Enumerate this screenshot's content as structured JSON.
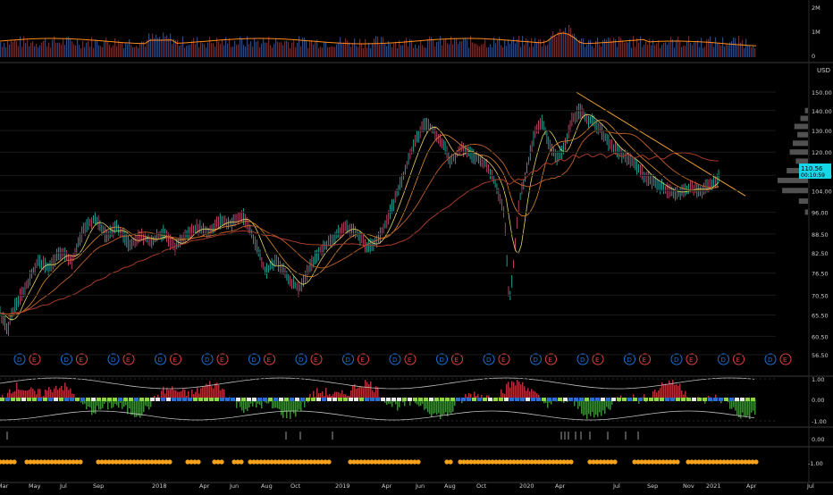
{
  "chart_data": {
    "type": "line",
    "currency_label": "USD",
    "price_tag": "110.56",
    "price_tag_sub": "00:10:59",
    "price_ticks": [
      "150.00",
      "140.00",
      "130.00",
      "120.00",
      "110.00",
      "104.00",
      "96.00",
      "88.50",
      "82.50",
      "76.50",
      "70.50",
      "65.50",
      "60.50",
      "56.50"
    ],
    "price_tick_values": [
      150,
      140,
      130,
      120,
      110,
      104,
      96,
      88.5,
      82.5,
      76.5,
      70.5,
      65.5,
      60.5,
      56.5
    ],
    "volume_ticks": [
      "2M",
      "1M",
      "0"
    ],
    "osc_ticks": [
      "1.00",
      "0.00",
      "-1.00"
    ],
    "small_ticks": [
      "0.00"
    ],
    "dot_ticks": [
      "-1.00"
    ],
    "time_labels": [
      "Mar",
      "May",
      "Jul",
      "Sep",
      "2018",
      "Apr",
      "Jun",
      "Aug",
      "Oct",
      "2019",
      "Apr",
      "Jun",
      "Aug",
      "Oct",
      "2020",
      "Apr",
      "Jul",
      "Sep",
      "Nov",
      "2021",
      "Apr",
      "Jul"
    ],
    "events": [
      "D",
      "E",
      "D",
      "E",
      "D",
      "E",
      "D",
      "E",
      "D",
      "E",
      "D",
      "E",
      "D",
      "E",
      "D",
      "E",
      "D",
      "E",
      "D",
      "E",
      "D",
      "E",
      "D",
      "E",
      "D",
      "E",
      "D",
      "E",
      "D",
      "E",
      "D",
      "E",
      "D",
      "E"
    ],
    "event_colors": {
      "D": "#1e6fd9",
      "E": "#e04040"
    },
    "price_series": [
      {
        "t": 0.0,
        "v": 66
      },
      {
        "t": 0.01,
        "v": 62
      },
      {
        "t": 0.02,
        "v": 68
      },
      {
        "t": 0.035,
        "v": 73
      },
      {
        "t": 0.05,
        "v": 80
      },
      {
        "t": 0.065,
        "v": 78
      },
      {
        "t": 0.08,
        "v": 83
      },
      {
        "t": 0.095,
        "v": 80
      },
      {
        "t": 0.11,
        "v": 90
      },
      {
        "t": 0.125,
        "v": 94
      },
      {
        "t": 0.14,
        "v": 88
      },
      {
        "t": 0.155,
        "v": 91
      },
      {
        "t": 0.17,
        "v": 85
      },
      {
        "t": 0.185,
        "v": 88
      },
      {
        "t": 0.2,
        "v": 86
      },
      {
        "t": 0.215,
        "v": 89
      },
      {
        "t": 0.23,
        "v": 84
      },
      {
        "t": 0.245,
        "v": 88
      },
      {
        "t": 0.26,
        "v": 91
      },
      {
        "t": 0.275,
        "v": 89
      },
      {
        "t": 0.29,
        "v": 93
      },
      {
        "t": 0.305,
        "v": 92
      },
      {
        "t": 0.32,
        "v": 95
      },
      {
        "t": 0.335,
        "v": 87
      },
      {
        "t": 0.35,
        "v": 77
      },
      {
        "t": 0.365,
        "v": 80
      },
      {
        "t": 0.38,
        "v": 75
      },
      {
        "t": 0.395,
        "v": 72
      },
      {
        "t": 0.41,
        "v": 79
      },
      {
        "t": 0.425,
        "v": 84
      },
      {
        "t": 0.44,
        "v": 87
      },
      {
        "t": 0.455,
        "v": 91
      },
      {
        "t": 0.47,
        "v": 89
      },
      {
        "t": 0.485,
        "v": 84
      },
      {
        "t": 0.5,
        "v": 87
      },
      {
        "t": 0.515,
        "v": 96
      },
      {
        "t": 0.53,
        "v": 108
      },
      {
        "t": 0.545,
        "v": 122
      },
      {
        "t": 0.56,
        "v": 134
      },
      {
        "t": 0.57,
        "v": 131
      },
      {
        "t": 0.58,
        "v": 126
      },
      {
        "t": 0.595,
        "v": 116
      },
      {
        "t": 0.61,
        "v": 122
      },
      {
        "t": 0.625,
        "v": 118
      },
      {
        "t": 0.64,
        "v": 115
      },
      {
        "t": 0.655,
        "v": 106
      },
      {
        "t": 0.665,
        "v": 96
      },
      {
        "t": 0.672,
        "v": 68
      },
      {
        "t": 0.678,
        "v": 80
      },
      {
        "t": 0.685,
        "v": 100
      },
      {
        "t": 0.695,
        "v": 112
      },
      {
        "t": 0.705,
        "v": 128
      },
      {
        "t": 0.715,
        "v": 134
      },
      {
        "t": 0.725,
        "v": 124
      },
      {
        "t": 0.735,
        "v": 117
      },
      {
        "t": 0.745,
        "v": 122
      },
      {
        "t": 0.755,
        "v": 136
      },
      {
        "t": 0.765,
        "v": 140
      },
      {
        "t": 0.775,
        "v": 136
      },
      {
        "t": 0.79,
        "v": 132
      },
      {
        "t": 0.805,
        "v": 123
      },
      {
        "t": 0.82,
        "v": 119
      },
      {
        "t": 0.835,
        "v": 116
      },
      {
        "t": 0.85,
        "v": 110
      },
      {
        "t": 0.865,
        "v": 107
      },
      {
        "t": 0.88,
        "v": 104
      },
      {
        "t": 0.895,
        "v": 103
      },
      {
        "t": 0.91,
        "v": 105
      },
      {
        "t": 0.925,
        "v": 104
      },
      {
        "t": 0.94,
        "v": 107
      },
      {
        "t": 0.95,
        "v": 110.56
      }
    ],
    "trendline": [
      {
        "t": 0.76,
        "v": 150
      },
      {
        "t": 0.96,
        "v": 104
      }
    ],
    "volume_profile_levels": [
      {
        "v": 140,
        "w": 0.1
      },
      {
        "v": 136,
        "w": 0.25
      },
      {
        "v": 132,
        "w": 0.45
      },
      {
        "v": 128,
        "w": 0.35
      },
      {
        "v": 124,
        "w": 0.5
      },
      {
        "v": 120,
        "w": 0.6
      },
      {
        "v": 116,
        "w": 0.4
      },
      {
        "v": 112,
        "w": 0.7
      },
      {
        "v": 108,
        "w": 1.0
      },
      {
        "v": 104,
        "w": 0.85
      },
      {
        "v": 100,
        "w": 0.3
      },
      {
        "v": 96,
        "w": 0.1
      }
    ]
  }
}
